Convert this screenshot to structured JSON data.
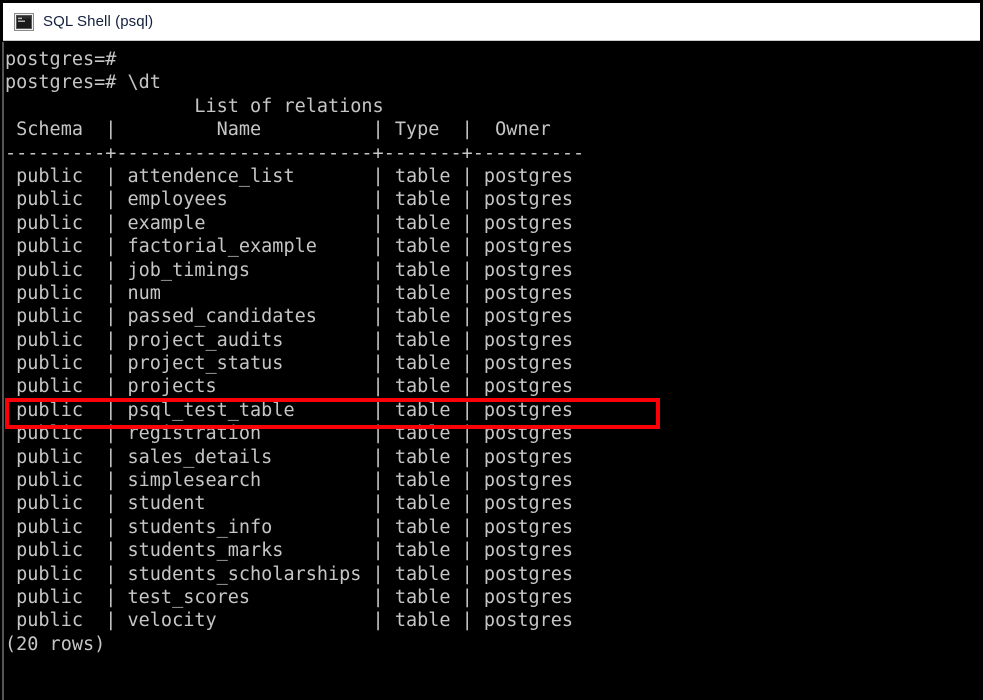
{
  "window": {
    "title": "SQL Shell (psql)",
    "icon": "console-icon",
    "titlebar_bg": "#ffffff",
    "titlebar_text_color": "#14213d",
    "console_bg": "#000000",
    "console_text_color": "#c6c6c6"
  },
  "terminal": {
    "prompt": "postgres=#",
    "command": "\\dt",
    "report_title": "List of relations",
    "columns": [
      {
        "label": "Schema",
        "width": 9
      },
      {
        "label": "Name",
        "width": 23
      },
      {
        "label": "Type",
        "width": 7
      },
      {
        "label": "Owner",
        "width": 10
      }
    ],
    "rows": [
      {
        "schema": "public",
        "name": "attendence_list",
        "type": "table",
        "owner": "postgres"
      },
      {
        "schema": "public",
        "name": "employees",
        "type": "table",
        "owner": "postgres"
      },
      {
        "schema": "public",
        "name": "example",
        "type": "table",
        "owner": "postgres"
      },
      {
        "schema": "public",
        "name": "factorial_example",
        "type": "table",
        "owner": "postgres"
      },
      {
        "schema": "public",
        "name": "job_timings",
        "type": "table",
        "owner": "postgres"
      },
      {
        "schema": "public",
        "name": "num",
        "type": "table",
        "owner": "postgres"
      },
      {
        "schema": "public",
        "name": "passed_candidates",
        "type": "table",
        "owner": "postgres"
      },
      {
        "schema": "public",
        "name": "project_audits",
        "type": "table",
        "owner": "postgres"
      },
      {
        "schema": "public",
        "name": "project_status",
        "type": "table",
        "owner": "postgres"
      },
      {
        "schema": "public",
        "name": "projects",
        "type": "table",
        "owner": "postgres"
      },
      {
        "schema": "public",
        "name": "psql_test_table",
        "type": "table",
        "owner": "postgres"
      },
      {
        "schema": "public",
        "name": "registration",
        "type": "table",
        "owner": "postgres"
      },
      {
        "schema": "public",
        "name": "sales_details",
        "type": "table",
        "owner": "postgres"
      },
      {
        "schema": "public",
        "name": "simplesearch",
        "type": "table",
        "owner": "postgres"
      },
      {
        "schema": "public",
        "name": "student",
        "type": "table",
        "owner": "postgres"
      },
      {
        "schema": "public",
        "name": "students_info",
        "type": "table",
        "owner": "postgres"
      },
      {
        "schema": "public",
        "name": "students_marks",
        "type": "table",
        "owner": "postgres"
      },
      {
        "schema": "public",
        "name": "students_scholarships",
        "type": "table",
        "owner": "postgres"
      },
      {
        "schema": "public",
        "name": "test_scores",
        "type": "table",
        "owner": "postgres"
      },
      {
        "schema": "public",
        "name": "velocity",
        "type": "table",
        "owner": "postgres"
      }
    ],
    "row_count_label": "(20 rows)"
  },
  "annotation": {
    "highlight_row_name": "psql_test_table",
    "color": "#fb0007",
    "shape": "rectangle"
  }
}
